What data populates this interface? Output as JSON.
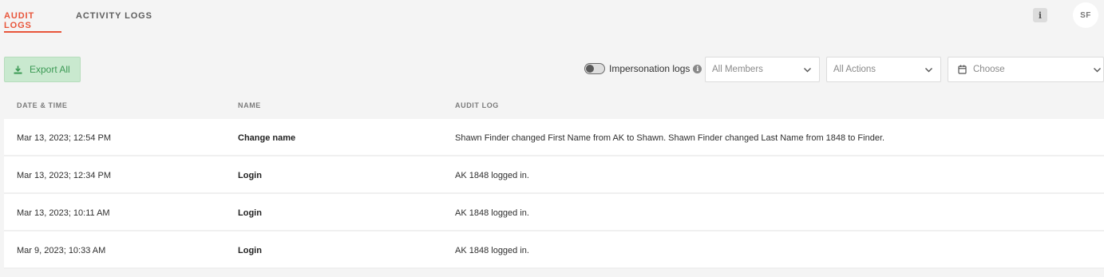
{
  "tabs": [
    {
      "label": "AUDIT LOGS",
      "active": true
    },
    {
      "label": "ACTIVITY LOGS",
      "active": false
    }
  ],
  "header": {
    "info_label": "i",
    "avatar_initials": "SF"
  },
  "toolbar": {
    "export_label": "Export All",
    "impersonation_label": "Impersonation logs",
    "impersonation_enabled": false,
    "members_placeholder": "All Members",
    "actions_placeholder": "All Actions",
    "date_placeholder": "Choose"
  },
  "table": {
    "columns": [
      "DATE & TIME",
      "NAME",
      "AUDIT LOG"
    ],
    "rows": [
      {
        "datetime": "Mar 13, 2023; 12:54 PM",
        "name": "Change name",
        "log": "Shawn Finder changed First Name from AK to Shawn. Shawn Finder changed Last Name from 1848 to Finder."
      },
      {
        "datetime": "Mar 13, 2023; 12:34 PM",
        "name": "Login",
        "log": "AK 1848 logged in."
      },
      {
        "datetime": "Mar 13, 2023; 10:11 AM",
        "name": "Login",
        "log": "AK 1848 logged in."
      },
      {
        "datetime": "Mar 9, 2023; 10:33 AM",
        "name": "Login",
        "log": "AK 1848 logged in."
      }
    ]
  },
  "colors": {
    "accent": "#e8553a",
    "export_bg": "#c9e9cf",
    "export_text": "#3c9a55"
  }
}
